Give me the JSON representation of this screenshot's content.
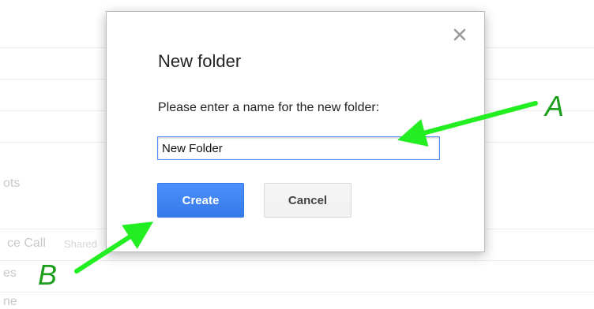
{
  "background_list": {
    "items": [
      {
        "label": "ots",
        "shared_label": ""
      },
      {
        "label": "ce Call",
        "shared_label": "Shared"
      },
      {
        "label": "es",
        "shared_label": ""
      },
      {
        "label": "ne",
        "shared_label": ""
      }
    ]
  },
  "dialog": {
    "title": "New folder",
    "prompt": "Please enter a name for the new folder:",
    "name_input_value": "New Folder",
    "create_label": "Create",
    "cancel_label": "Cancel",
    "close_icon": "close-icon"
  },
  "annotations": {
    "label_a": "A",
    "label_b": "B",
    "arrow_color": "#22ee22",
    "label_color": "#1b9e1b"
  },
  "colors": {
    "primary_button": "#4d90fe",
    "input_focus_border": "#4d90fe",
    "text_selection": "#bcd5f7"
  }
}
